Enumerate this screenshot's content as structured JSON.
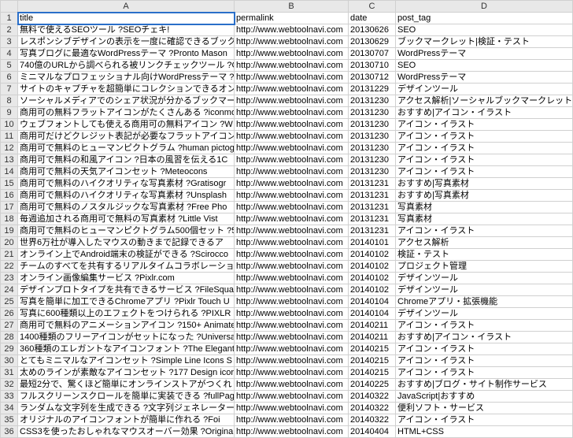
{
  "columns": {
    "A": "A",
    "B": "B",
    "C": "C",
    "D": "D"
  },
  "headers": {
    "title": "title",
    "permalink": "permalink",
    "date": "date",
    "post_tag": "post_tag"
  },
  "rows": [
    {
      "n": "1",
      "title": "title",
      "permalink": "permalink",
      "date": "date",
      "tag": "post_tag"
    },
    {
      "n": "2",
      "title": "無料で使えるSEOツール ?SEOチェキ!",
      "permalink": "http://www.webtoolnavi.com",
      "date": "20130626",
      "tag": "SEO"
    },
    {
      "n": "3",
      "title": "レスポンシブデザインの表示を一度に確認できるブック",
      "permalink": "http://www.webtoolnavi.com",
      "date": "20130629",
      "tag": "ブックマークレット|検証・テスト"
    },
    {
      "n": "4",
      "title": "写真ブログに最適なWordPressテーマ ?Pronto Mason",
      "permalink": "http://www.webtoolnavi.com",
      "date": "20130707",
      "tag": "WordPressテーマ"
    },
    {
      "n": "5",
      "title": "740億のURLから調べられる被リンクチェックツール ?C",
      "permalink": "http://www.webtoolnavi.com",
      "date": "20130710",
      "tag": "SEO"
    },
    {
      "n": "6",
      "title": "ミニマルなプロフェッショナル向けWordPressテーマ ?Al",
      "permalink": "http://www.webtoolnavi.com",
      "date": "20130712",
      "tag": "WordPressテーマ"
    },
    {
      "n": "7",
      "title": "サイトのキャプチャを超簡単にコレクションできるオンラ",
      "permalink": "http://www.webtoolnavi.com",
      "date": "20131229",
      "tag": "デザインツール"
    },
    {
      "n": "8",
      "title": "ソーシャルメディアでのシェア状況が分かるブックマー",
      "permalink": "http://www.webtoolnavi.com",
      "date": "20131230",
      "tag": "アクセス解析|ソーシャルブックマークレット"
    },
    {
      "n": "9",
      "title": "商用可の無料フラットアイコンがたくさんある ?iconmor",
      "permalink": "http://www.webtoolnavi.com",
      "date": "20131230",
      "tag": "おすすめ|アイコン・イラスト"
    },
    {
      "n": "10",
      "title": "ウェブフォントしても使える商用可の無料アイコン ?W",
      "permalink": "http://www.webtoolnavi.com",
      "date": "20131230",
      "tag": "アイコン・イラスト"
    },
    {
      "n": "11",
      "title": "商用可だけどクレジット表記が必要なフラットアイコン集",
      "permalink": "http://www.webtoolnavi.com",
      "date": "20131230",
      "tag": "アイコン・イラスト"
    },
    {
      "n": "12",
      "title": "商用可で無料のヒューマンピクトグラム ?human pictog",
      "permalink": "http://www.webtoolnavi.com",
      "date": "20131230",
      "tag": "アイコン・イラスト"
    },
    {
      "n": "13",
      "title": "商用可で無料の和風アイコン ?日本の風習を伝える1C",
      "permalink": "http://www.webtoolnavi.com",
      "date": "20131230",
      "tag": "アイコン・イラスト"
    },
    {
      "n": "14",
      "title": "商用可で無料の天気アイコンセット ?Meteocons",
      "permalink": "http://www.webtoolnavi.com",
      "date": "20131230",
      "tag": "アイコン・イラスト"
    },
    {
      "n": "15",
      "title": "商用可で無料のハイクオリティな写真素材 ?Gratisogr",
      "permalink": "http://www.webtoolnavi.com",
      "date": "20131231",
      "tag": "おすすめ|写真素材"
    },
    {
      "n": "16",
      "title": "商用可で無料のハイクオリティな写真素材 ?Unsplash",
      "permalink": "http://www.webtoolnavi.com",
      "date": "20131231",
      "tag": "おすすめ|写真素材"
    },
    {
      "n": "17",
      "title": "商用可で無料のノスタルジックな写真素材 ?Free Pho",
      "permalink": "http://www.webtoolnavi.com",
      "date": "20131231",
      "tag": "写真素材"
    },
    {
      "n": "18",
      "title": "毎週追加される商用可で無料の写真素材 ?Little Vist",
      "permalink": "http://www.webtoolnavi.com",
      "date": "20131231",
      "tag": "写真素材"
    },
    {
      "n": "19",
      "title": "商用可で無料のヒューマンピクトグラム500個セット ?5",
      "permalink": "http://www.webtoolnavi.com",
      "date": "20131231",
      "tag": "アイコン・イラスト"
    },
    {
      "n": "20",
      "title": "世界6万社が導入したマウスの動きまで記録できるア",
      "permalink": "http://www.webtoolnavi.com",
      "date": "20140101",
      "tag": "アクセス解析"
    },
    {
      "n": "21",
      "title": "オンライン上でAndroid端末の検証ができる ?Scirocco",
      "permalink": "http://www.webtoolnavi.com",
      "date": "20140102",
      "tag": "検証・テスト"
    },
    {
      "n": "22",
      "title": "チームのすべてを共有するリアルタイムコラボレーショ",
      "permalink": "http://www.webtoolnavi.com",
      "date": "20140102",
      "tag": "プロジェクト管理"
    },
    {
      "n": "23",
      "title": "オンライン画像編集サービス ?Pixlr.com",
      "permalink": "http://www.webtoolnavi.com",
      "date": "20140102",
      "tag": "デザインツール"
    },
    {
      "n": "24",
      "title": "デザインプロトタイプを共有できるサービス ?FileSquare",
      "permalink": "http://www.webtoolnavi.com",
      "date": "20140102",
      "tag": "デザインツール"
    },
    {
      "n": "25",
      "title": "写真を簡単に加工できるChromeアプリ ?Pixlr Touch U",
      "permalink": "http://www.webtoolnavi.com",
      "date": "20140104",
      "tag": "Chromeアプリ・拡張機能"
    },
    {
      "n": "26",
      "title": "写真に600種類以上のエフェクトをつけられる ?PIXLR",
      "permalink": "http://www.webtoolnavi.com",
      "date": "20140104",
      "tag": "デザインツール"
    },
    {
      "n": "27",
      "title": "商用可で無料のアニメーションアイコン ?150+ Animate",
      "permalink": "http://www.webtoolnavi.com",
      "date": "20140211",
      "tag": "アイコン・イラスト"
    },
    {
      "n": "28",
      "title": "1400種類のフリーアイコンがセットになった ?Universa",
      "permalink": "http://www.webtoolnavi.com",
      "date": "20140211",
      "tag": "おすすめ|アイコン・イラスト"
    },
    {
      "n": "29",
      "title": "360種類のエレガントなアイコンフォント ?The Elegant I",
      "permalink": "http://www.webtoolnavi.com",
      "date": "20140215",
      "tag": "アイコン・イラスト"
    },
    {
      "n": "30",
      "title": "とてもミニマルなアイコンセット ?Simple Line Icons S",
      "permalink": "http://www.webtoolnavi.com",
      "date": "20140215",
      "tag": "アイコン・イラスト"
    },
    {
      "n": "31",
      "title": "太めのラインが素敵なアイコンセット ?177 Design icor",
      "permalink": "http://www.webtoolnavi.com",
      "date": "20140215",
      "tag": "アイコン・イラスト"
    },
    {
      "n": "32",
      "title": "最短2分で、驚くほど簡単にオンラインストアがつくれ",
      "permalink": "http://www.webtoolnavi.com",
      "date": "20140225",
      "tag": "おすすめ|ブログ・サイト制作サービス"
    },
    {
      "n": "33",
      "title": "フルスクリーンスクロールを簡単に実装できる ?fullPag",
      "permalink": "http://www.webtoolnavi.com",
      "date": "20140322",
      "tag": "JavaScript|おすすめ"
    },
    {
      "n": "34",
      "title": "ランダムな文字列を生成できる ?文字列ジェネレーター",
      "permalink": "http://www.webtoolnavi.com",
      "date": "20140322",
      "tag": "便利ソフト・サービス"
    },
    {
      "n": "35",
      "title": "オリジナルのアイコンフォントが簡単に作れる ?Foi",
      "permalink": "http://www.webtoolnavi.com",
      "date": "20140322",
      "tag": "アイコン・イラスト"
    },
    {
      "n": "36",
      "title": "CSS3を使ったおしゃれなマウスオーバー効果 ?Origina",
      "permalink": "http://www.webtoolnavi.com",
      "date": "20140404",
      "tag": "HTML+CSS"
    }
  ]
}
